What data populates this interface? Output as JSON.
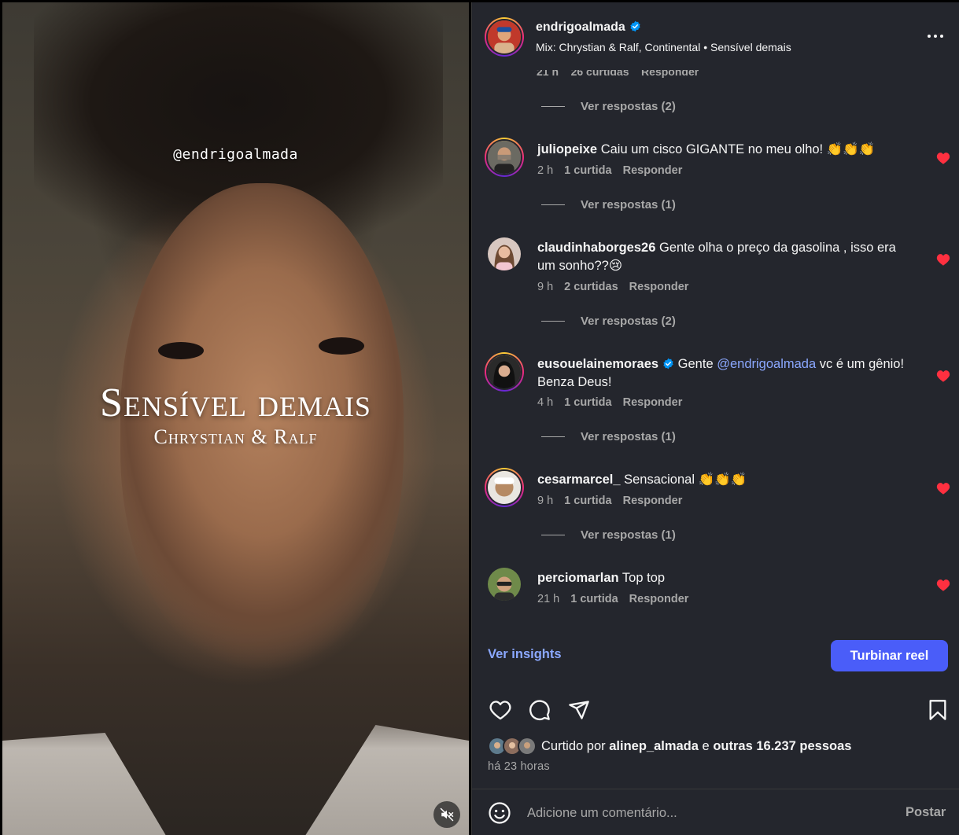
{
  "reel": {
    "handle_overlay": "@endrigoalmada",
    "song_title": "Sensível demais",
    "song_artist": "Chrystian & Ralf"
  },
  "header": {
    "username": "endrigoalmada",
    "audio": "Mix: Chrystian & Ralf, Continental • Sensível demais"
  },
  "partial_comment_meta": "21 h    26 curtidas    Responder",
  "first_view_replies": "Ver respostas (2)",
  "comments": [
    {
      "user": "juliopeixe",
      "text": "Caiu um cisco GIGANTE no meu olho! 👏👏👏",
      "time": "2 h",
      "likes": "1 curtida",
      "reply": "Responder",
      "view_replies": "Ver respostas (1)"
    },
    {
      "user": "claudinhaborges26",
      "text": "Gente olha o preço da gasolina , isso era um sonho??😢",
      "time": "9 h",
      "likes": "2 curtidas",
      "reply": "Responder",
      "view_replies": "Ver respostas (2)"
    },
    {
      "user": "eusouelainemoraes",
      "text_before": "Gente",
      "mention": "@endrigoalmada",
      "text_after": "vc é um gênio! Benza Deus!",
      "time": "4 h",
      "likes": "1 curtida",
      "reply": "Responder",
      "view_replies": "Ver respostas (1)"
    },
    {
      "user": "cesarmarcel_",
      "text": "Sensacional 👏👏👏",
      "time": "9 h",
      "likes": "1 curtida",
      "reply": "Responder",
      "view_replies": "Ver respostas (1)"
    },
    {
      "user": "perciomarlan",
      "text": "Top top",
      "time": "21 h",
      "likes": "1 curtida",
      "reply": "Responder"
    }
  ],
  "insights": {
    "link": "Ver insights",
    "boost": "Turbinar reel"
  },
  "likes": {
    "prefix": "Curtido por",
    "user": "alinep_almada",
    "middle": "e",
    "others": "outras 16.237 pessoas"
  },
  "time_ago": "há 23 horas",
  "comment_box": {
    "placeholder": "Adicione um comentário...",
    "post": "Postar"
  },
  "colors": {
    "panel_bg": "#24262d",
    "accent_blue": "#4a5df9",
    "link_blue": "#8ba8ff",
    "heart_red": "#ff3040",
    "verified_blue": "#0095f6"
  },
  "icons": [
    "heart-icon",
    "comment-icon",
    "share-icon",
    "bookmark-icon",
    "emoji-icon",
    "more-options-icon",
    "muted-speaker-icon",
    "verified-badge-icon"
  ]
}
